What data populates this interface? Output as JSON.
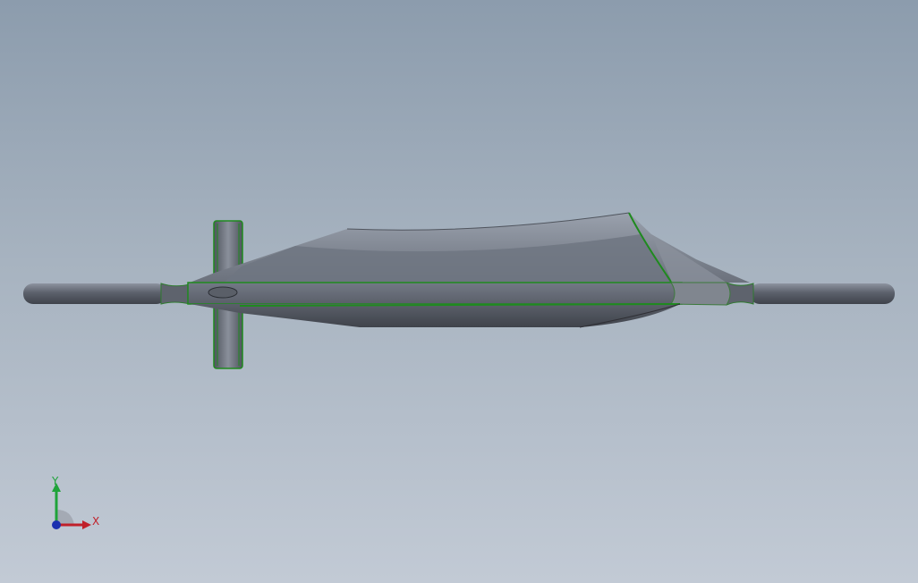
{
  "viewport": {
    "background_top": "#8c9cad",
    "background_bottom": "#c2cad5"
  },
  "model": {
    "body_color": "#6d7380",
    "edge_color": "#1f8a1f"
  },
  "triad": {
    "x_label": "X",
    "y_label": "Y",
    "x_color": "#c0202a",
    "y_color": "#1fa33a",
    "z_color": "#1a2fb0"
  }
}
